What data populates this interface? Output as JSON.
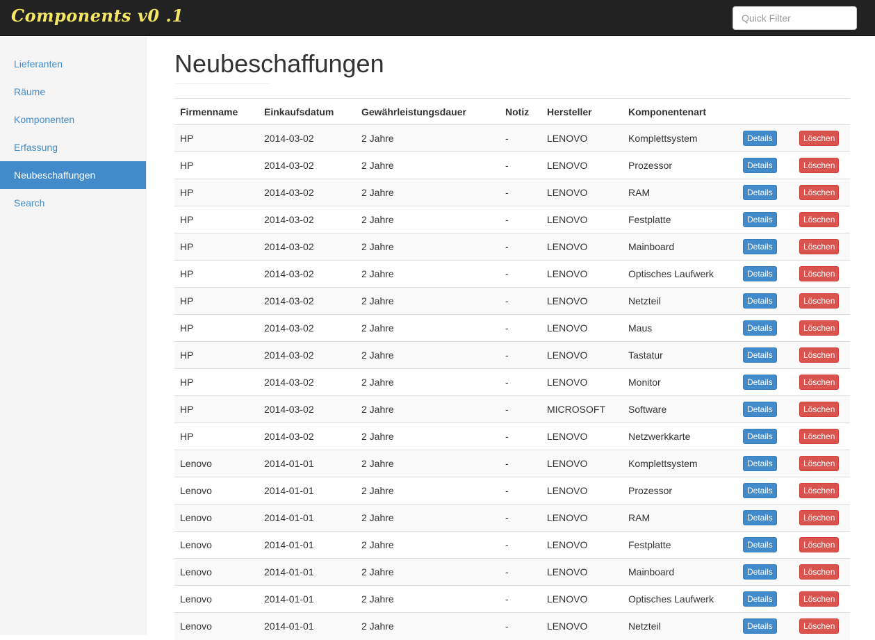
{
  "app": {
    "brand": "Components v0 .1"
  },
  "search": {
    "placeholder": "Quick Filter"
  },
  "sidebar": {
    "items": [
      {
        "label": "Lieferanten",
        "active": false
      },
      {
        "label": "Räume",
        "active": false
      },
      {
        "label": "Komponenten",
        "active": false
      },
      {
        "label": "Erfassung",
        "active": false
      },
      {
        "label": "Neubeschaffungen",
        "active": true
      },
      {
        "label": "Search",
        "active": false
      }
    ]
  },
  "main": {
    "title": "Neubeschaffungen"
  },
  "table": {
    "headers": [
      "Firmenname",
      "Einkaufsdatum",
      "Gewährleistungsdauer",
      "Notiz",
      "Hersteller",
      "Komponentenart",
      "",
      ""
    ],
    "details_label": "Details",
    "delete_label": "Löschen",
    "rows": [
      [
        "HP",
        "2014-03-02",
        "2 Jahre",
        "-",
        "LENOVO",
        "Komplettsystem"
      ],
      [
        "HP",
        "2014-03-02",
        "2 Jahre",
        "-",
        "LENOVO",
        "Prozessor"
      ],
      [
        "HP",
        "2014-03-02",
        "2 Jahre",
        "-",
        "LENOVO",
        "RAM"
      ],
      [
        "HP",
        "2014-03-02",
        "2 Jahre",
        "-",
        "LENOVO",
        "Festplatte"
      ],
      [
        "HP",
        "2014-03-02",
        "2 Jahre",
        "-",
        "LENOVO",
        "Mainboard"
      ],
      [
        "HP",
        "2014-03-02",
        "2 Jahre",
        "-",
        "LENOVO",
        "Optisches Laufwerk"
      ],
      [
        "HP",
        "2014-03-02",
        "2 Jahre",
        "-",
        "LENOVO",
        "Netzteil"
      ],
      [
        "HP",
        "2014-03-02",
        "2 Jahre",
        "-",
        "LENOVO",
        "Maus"
      ],
      [
        "HP",
        "2014-03-02",
        "2 Jahre",
        "-",
        "LENOVO",
        "Tastatur"
      ],
      [
        "HP",
        "2014-03-02",
        "2 Jahre",
        "-",
        "LENOVO",
        "Monitor"
      ],
      [
        "HP",
        "2014-03-02",
        "2 Jahre",
        "-",
        "MICROSOFT",
        "Software"
      ],
      [
        "HP",
        "2014-03-02",
        "2 Jahre",
        "-",
        "LENOVO",
        "Netzwerkkarte"
      ],
      [
        "Lenovo",
        "2014-01-01",
        "2 Jahre",
        "-",
        "LENOVO",
        "Komplettsystem"
      ],
      [
        "Lenovo",
        "2014-01-01",
        "2 Jahre",
        "-",
        "LENOVO",
        "Prozessor"
      ],
      [
        "Lenovo",
        "2014-01-01",
        "2 Jahre",
        "-",
        "LENOVO",
        "RAM"
      ],
      [
        "Lenovo",
        "2014-01-01",
        "2 Jahre",
        "-",
        "LENOVO",
        "Festplatte"
      ],
      [
        "Lenovo",
        "2014-01-01",
        "2 Jahre",
        "-",
        "LENOVO",
        "Mainboard"
      ],
      [
        "Lenovo",
        "2014-01-01",
        "2 Jahre",
        "-",
        "LENOVO",
        "Optisches Laufwerk"
      ],
      [
        "Lenovo",
        "2014-01-01",
        "2 Jahre",
        "-",
        "LENOVO",
        "Netzteil"
      ]
    ]
  },
  "colors": {
    "navbar": "#222222",
    "brand": "#f5e663",
    "link": "#428bca",
    "details": "#428bca",
    "delete": "#d9534f"
  }
}
